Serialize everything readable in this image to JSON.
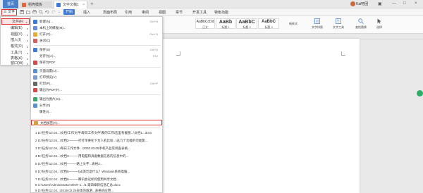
{
  "tabs": {
    "home": "首页",
    "t1": "稻壳模板",
    "t2": "文字文稿1"
  },
  "user": {
    "name": "Kai吧团"
  },
  "menu": {
    "file": "三 文件",
    "items": [
      "开始",
      "插入",
      "页面布局",
      "引用",
      "审阅",
      "视图",
      "章节",
      "开发工具",
      "特色功能"
    ],
    "active": "开始"
  },
  "ribbon": {
    "styles": [
      {
        "preview": "AaBbCcDd",
        "label": "正文"
      },
      {
        "preview": "AaBb",
        "label": "标题 1"
      },
      {
        "preview": "AaBbC",
        "label": "标题 2"
      },
      {
        "preview": "AaBbC",
        "label": "标题 3"
      }
    ],
    "buttons": [
      "新样式",
      "文字排版",
      "文字工具",
      "查找替换",
      "选择"
    ]
  },
  "left_menu": [
    {
      "label": "文件(F)",
      "arrow": "▸"
    },
    {
      "label": "编辑(E)",
      "arrow": "▸"
    },
    {
      "label": "视图(V)",
      "arrow": "▸"
    },
    {
      "label": "插入(I)",
      "arrow": "▸"
    },
    {
      "label": "格式(O)",
      "arrow": "▸"
    },
    {
      "label": "工具(T)",
      "arrow": "▸"
    },
    {
      "label": "表格(A)",
      "arrow": "▸"
    },
    {
      "label": "窗口(W)",
      "arrow": "▸"
    }
  ],
  "submenu": {
    "items": [
      {
        "label": "新建(N)...",
        "shortcut": "Ctrl+N"
      },
      {
        "label": "本机上的模板(M)...",
        "shortcut": ""
      },
      {
        "label": "打开(O)...",
        "shortcut": "Ctrl+O"
      },
      {
        "label": "关闭(C)",
        "shortcut": ""
      },
      {
        "label": "保存(S)",
        "shortcut": "Ctrl+S"
      },
      {
        "label": "另存为(A)...",
        "shortcut": "F12"
      },
      {
        "label": "保存为PDF",
        "shortcut": ""
      },
      {
        "label": "页面设置(U)...",
        "shortcut": ""
      },
      {
        "label": "打印预览(V)",
        "shortcut": ""
      },
      {
        "label": "打印(P)...",
        "shortcut": "Ctrl+P"
      },
      {
        "label": "输出为PDF(F)...",
        "shortcut": ""
      },
      {
        "label": "输出为图片(G)...",
        "shortcut": ""
      },
      {
        "label": "分享(D)",
        "shortcut": ""
      },
      {
        "label": "属性(I)...",
        "shortcut": ""
      },
      {
        "label": "文档加密(Y)...",
        "shortcut": ""
      }
    ],
    "recent": [
      "1 D:\\任务\\12.04...\\文档\\工作文件\\每日工作文件\\我的工作\\这里有截图...\\文档1...docx",
      "2 D:\\任务\\12.04...\\文档2———打打单要在下为人机比较...\\这几个功能的可能影...",
      "3 D:\\任务\\12.04...\\每日工作文件...\\2020.03.05手机产品常调查表格...",
      "4 D:\\任务\\12.04...\\文档3———用电脑和具备数据信息的信息中的...",
      "5 D:\\任务\\12.04...\\文档———路上文字...表格2...",
      "6 D:\\任务\\12.04...\\文档5———fab演示是什么？Windows系统电脑...",
      "7 D:\\任务\\12.04...\\文档6———腾讯会议如何使用共享文档...",
      "8 C:\\Users\\Administrator.WIN7-1...\\1.第四章新信息汇总.docx",
      "9 D:\\任务\\12.04...\\2019.02.25日本的旅游...表格的应用..."
    ]
  }
}
